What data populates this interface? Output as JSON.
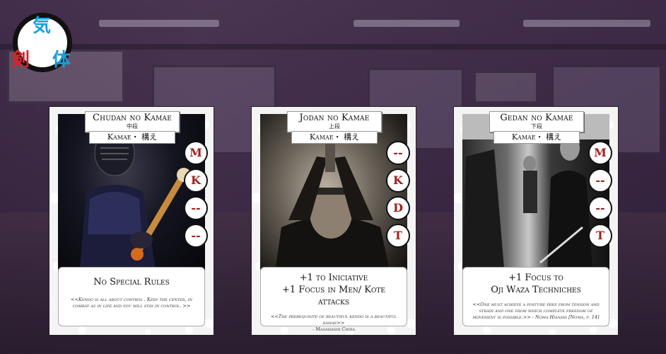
{
  "logo": {
    "kanji_top": "気",
    "kanji_left": "剣",
    "kanji_right": "体"
  },
  "cards": [
    {
      "title": "Chudan no Kamae",
      "title_jp": "中段",
      "subtitle": "Kamae・ 構え",
      "stances": [
        "M",
        "K",
        "--",
        "--"
      ],
      "rule": "No Special Rules",
      "quote": "<<Kendo is all about control . Keep the center, in combat as in life and you will stay in control.  >>",
      "attribution": ""
    },
    {
      "title": "Jodan no Kamae",
      "title_jp": "上段",
      "subtitle": "Kamae・ 構え",
      "stances": [
        "--",
        "K",
        "D",
        "T"
      ],
      "rule": "+1 to Iniciative\n+1 Focus in Men/ Kote attacks",
      "quote": "<<The prerequisite of beautiful kendo is a beautiful kamae>>",
      "attribution": "- Masahashi Chiba"
    },
    {
      "title": "Gedan no Kamae",
      "title_jp": "下段",
      "subtitle": "Kamae・ 構え",
      "stances": [
        "M",
        "--",
        "--",
        "T"
      ],
      "rule": "+1 Focus to\nOji Waza Techniches",
      "quote": "<<One must achieve a posture free from tension and strain and one from which complete freedom of movement is possible.>> - Noma Hisashi [Noma, p. 14]",
      "attribution": ""
    }
  ]
}
